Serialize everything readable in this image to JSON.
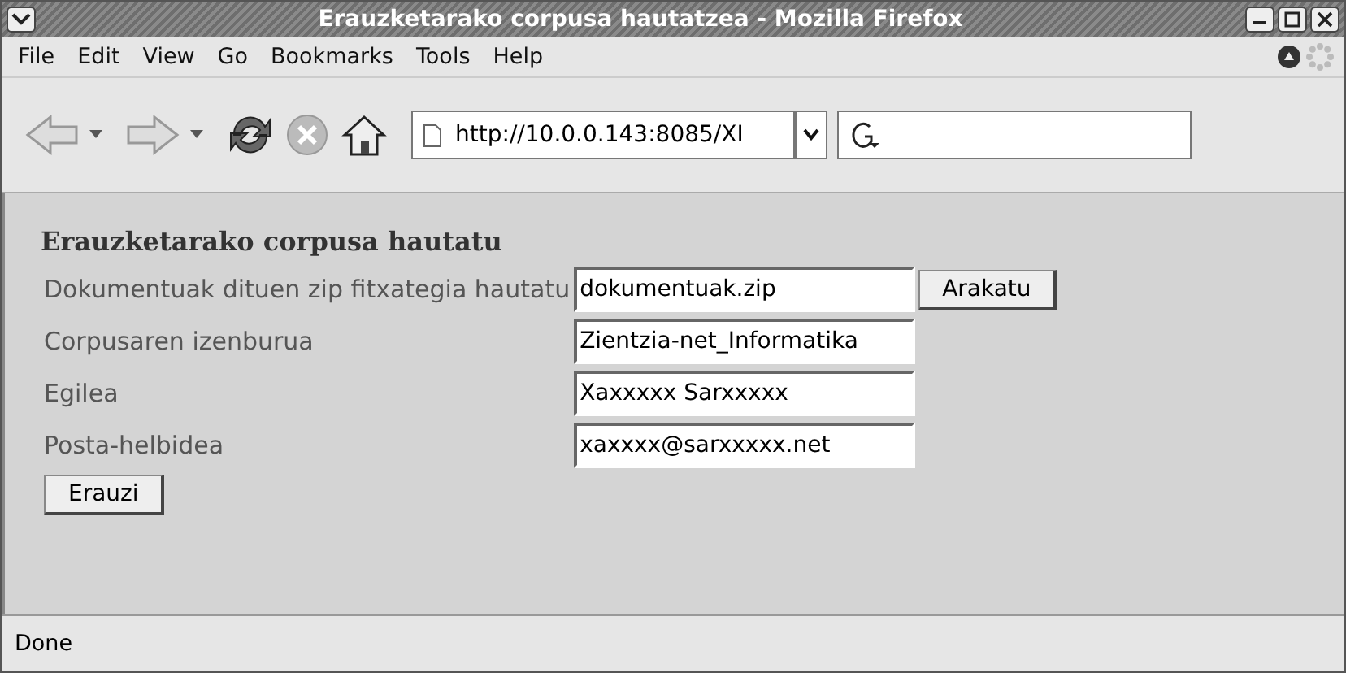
{
  "window": {
    "title": "Erauzketarako corpusa hautatzea - Mozilla Firefox"
  },
  "menu": [
    "File",
    "Edit",
    "View",
    "Go",
    "Bookmarks",
    "Tools",
    "Help"
  ],
  "toolbar": {
    "url": "http://10.0.0.143:8085/XI"
  },
  "page": {
    "heading": "Erauzketarako corpusa hautatu",
    "rows": [
      {
        "label": "Dokumentuak dituen zip fitxategia hautatu",
        "value": "dokumentuak.zip",
        "button": "Arakatu"
      },
      {
        "label": "Corpusaren izenburua",
        "value": "Zientzia-net_Informatika"
      },
      {
        "label": "Egilea",
        "value": "Xaxxxxx Sarxxxxx"
      },
      {
        "label": "Posta-helbidea",
        "value": "xaxxxx@sarxxxxx.net"
      }
    ],
    "submit": "Erauzi"
  },
  "status_bar": "Done"
}
